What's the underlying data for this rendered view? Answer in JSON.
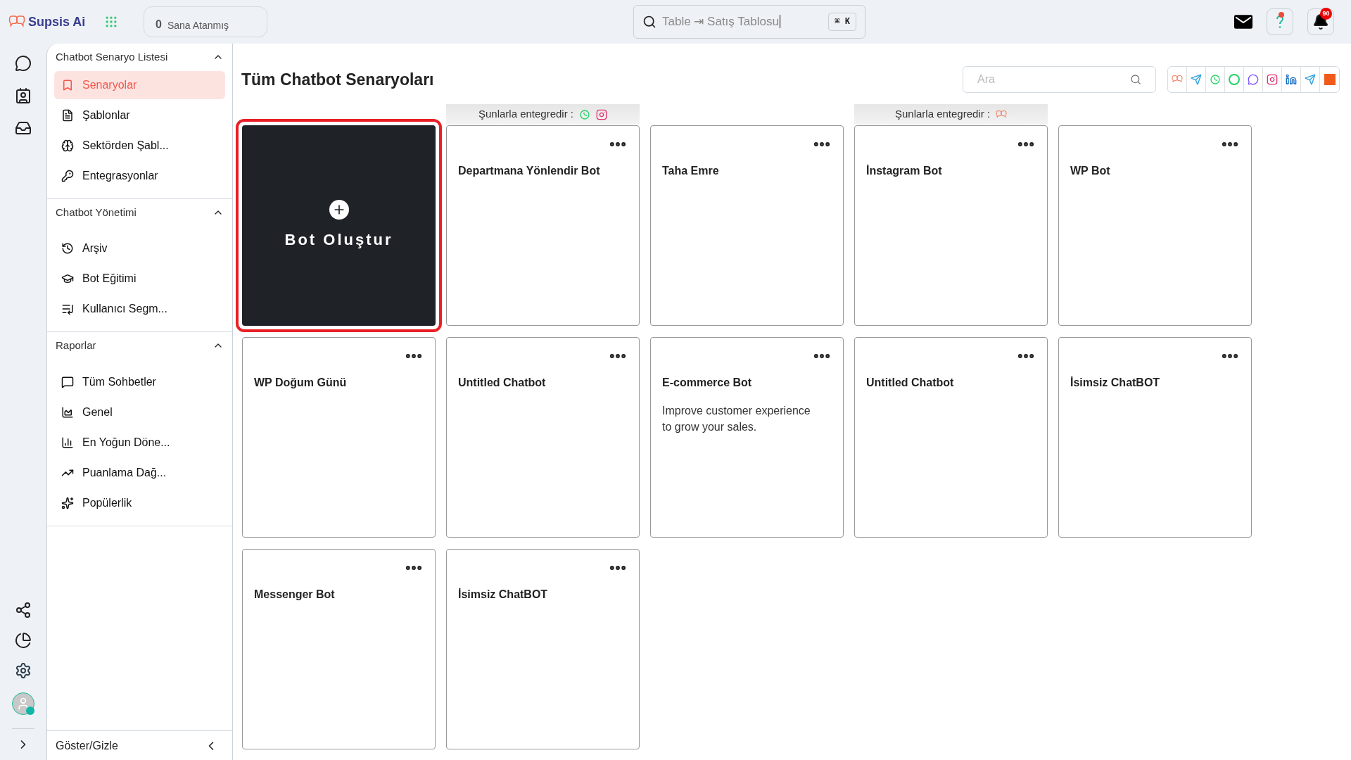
{
  "brand": {
    "name": "Supsis Ai"
  },
  "assigned": {
    "count": "0",
    "label": "Sana Atanmış"
  },
  "search": {
    "value": "Table ⇥ Satış Tablosu",
    "shortcut": "⌘ K"
  },
  "notifications": {
    "badge": "90"
  },
  "sidebar": {
    "sections": [
      {
        "title": "Chatbot Senaryo Listesi",
        "expanded": true,
        "items": [
          {
            "label": "Senaryolar",
            "selected": true
          },
          {
            "label": "Şablonlar",
            "selected": false
          },
          {
            "label": "Sektörden Şabl...",
            "selected": false
          },
          {
            "label": "Entegrasyonlar",
            "selected": false
          }
        ]
      },
      {
        "title": "Chatbot Yönetimi",
        "expanded": true,
        "items": [
          {
            "label": "Arşiv",
            "selected": false
          },
          {
            "label": "Bot Eğitimi",
            "selected": false
          },
          {
            "label": "Kullanıcı Segm...",
            "selected": false
          }
        ]
      },
      {
        "title": "Raporlar",
        "expanded": true,
        "items": [
          {
            "label": "Tüm Sohbetler",
            "selected": false
          },
          {
            "label": "Genel",
            "selected": false
          },
          {
            "label": "En Yoğun Döne...",
            "selected": false
          },
          {
            "label": "Puanlama Dağ...",
            "selected": false
          },
          {
            "label": "Popülerlik",
            "selected": false
          }
        ]
      }
    ],
    "footer": "Göster/Gizle"
  },
  "page": {
    "title": "Tüm Chatbot Senaryoları",
    "search_placeholder": "Ara"
  },
  "cards": [
    {
      "kind": "create",
      "title": "Bot Oluştur",
      "selected": true
    },
    {
      "kind": "bot",
      "title": "Departmana Yönlendir Bot",
      "integrated": {
        "label": "Şunlarla entegredir :",
        "channels": [
          {
            "kind": "whatsapp"
          },
          {
            "kind": "instagram"
          }
        ]
      }
    },
    {
      "kind": "bot",
      "title": "Taha Emre"
    },
    {
      "kind": "bot",
      "title": "İnstagram Bot",
      "integrated": {
        "label": "Şunlarla entegredir :",
        "channels": [
          {
            "kind": "supsis"
          }
        ]
      }
    },
    {
      "kind": "bot",
      "title": "WP Bot"
    },
    {
      "kind": "bot",
      "title": "WP Doğum Günü"
    },
    {
      "kind": "bot",
      "title": "Untitled Chatbot"
    },
    {
      "kind": "bot",
      "title": "E-commerce Bot",
      "description": "Improve customer experience to grow your sales."
    },
    {
      "kind": "bot",
      "title": "Untitled Chatbot"
    },
    {
      "kind": "bot",
      "title": "İsimsiz ChatBOT"
    },
    {
      "kind": "bot",
      "title": "Messenger Bot"
    },
    {
      "kind": "bot",
      "title": "İsimsiz ChatBOT"
    }
  ]
}
